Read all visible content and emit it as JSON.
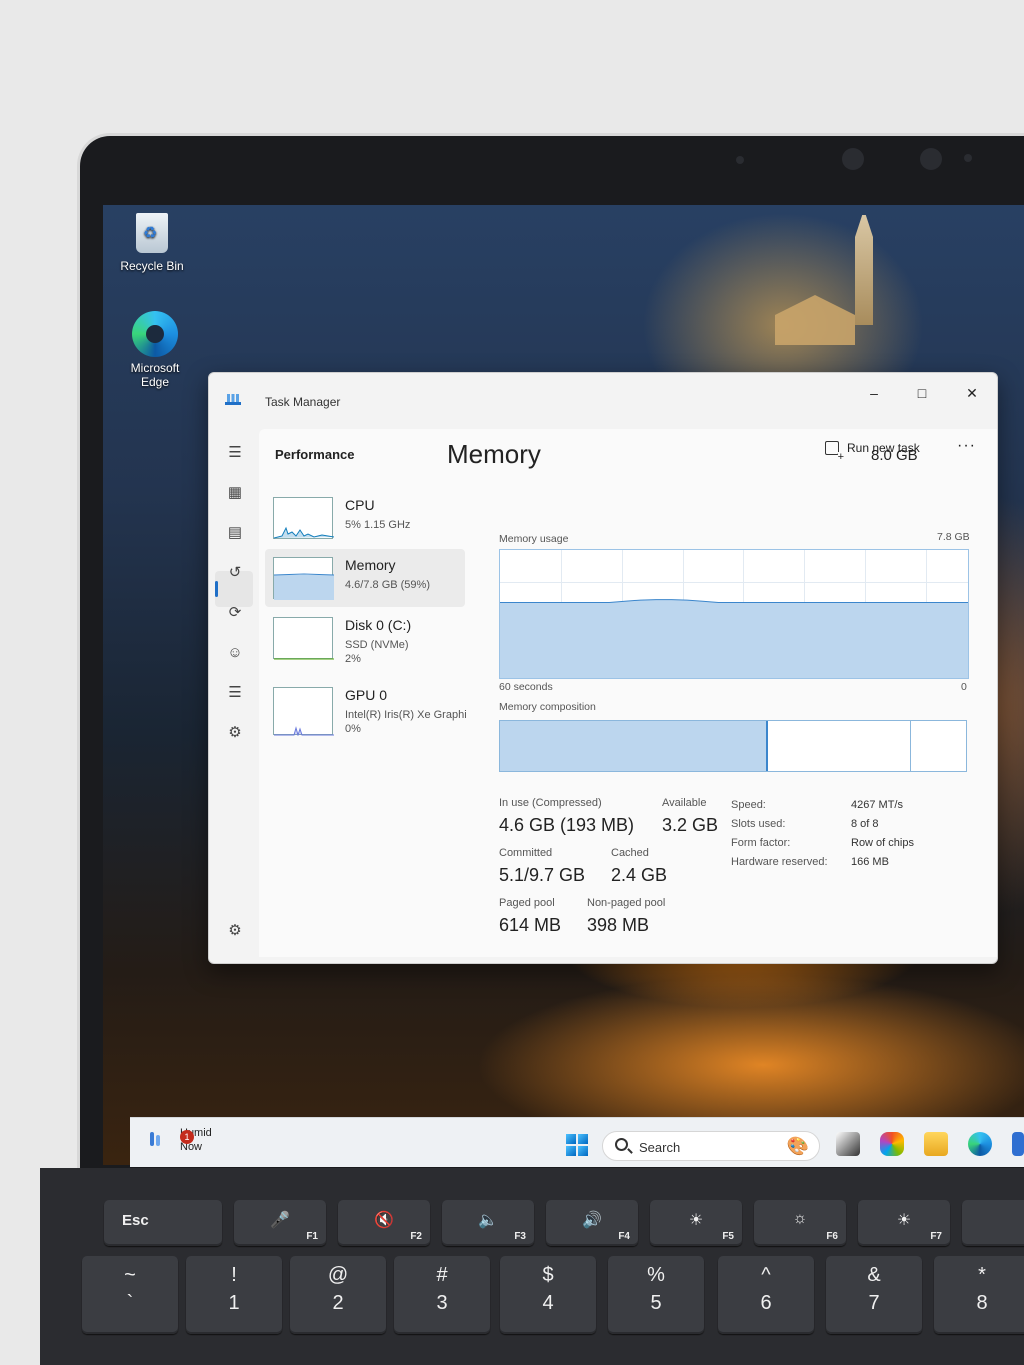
{
  "desktop": {
    "icons": [
      {
        "label": "Recycle Bin"
      },
      {
        "label_line1": "Microsoft",
        "label_line2": "Edge"
      }
    ]
  },
  "task_manager": {
    "title": "Task Manager",
    "window_controls": {
      "minimize": "–",
      "maximize": "□",
      "close": "✕"
    },
    "page_title": "Performance",
    "run_new_task": "Run new task",
    "more": "···",
    "resources": [
      {
        "name": "CPU",
        "sub1": "5%  1.15 GHz",
        "sub2": ""
      },
      {
        "name": "Memory",
        "sub1": "4.6/7.8 GB (59%)",
        "sub2": ""
      },
      {
        "name": "Disk 0 (C:)",
        "sub1": "SSD (NVMe)",
        "sub2": "2%"
      },
      {
        "name": "GPU 0",
        "sub1": "Intel(R) Iris(R) Xe Graphi",
        "sub2": "0%"
      }
    ],
    "memory": {
      "heading": "Memory",
      "total": "8.0 GB",
      "usage_label": "Memory usage",
      "usage_max": "7.8 GB",
      "x_left": "60 seconds",
      "x_right": "0",
      "usage_fraction": 0.59,
      "composition_label": "Memory composition",
      "composition": {
        "in_use": 0.575,
        "standby_end": 0.88
      },
      "stats": {
        "in_use_label": "In use (Compressed)",
        "in_use": "4.6 GB (193 MB)",
        "available_label": "Available",
        "available": "3.2 GB",
        "committed_label": "Committed",
        "committed": "5.1/9.7 GB",
        "cached_label": "Cached",
        "cached": "2.4 GB",
        "paged_label": "Paged pool",
        "paged": "614 MB",
        "nonpaged_label": "Non-paged pool",
        "nonpaged": "398 MB"
      },
      "specs": [
        {
          "label": "Speed:",
          "value": "4267 MT/s"
        },
        {
          "label": "Slots used:",
          "value": "8 of 8"
        },
        {
          "label": "Form factor:",
          "value": "Row of chips"
        },
        {
          "label": "Hardware reserved:",
          "value": "166 MB"
        }
      ]
    },
    "accent": "#1f6fc7"
  },
  "taskbar": {
    "weather_line1": "Humid",
    "weather_line2": "Now",
    "weather_badge": "1",
    "search_label": "Search"
  },
  "keyboard": {
    "row1": [
      {
        "main": "Esc",
        "fn": ""
      },
      {
        "main": "🎤",
        "fn": "F1"
      },
      {
        "main": "🔇",
        "fn": "F2"
      },
      {
        "main": "🔈",
        "fn": "F3"
      },
      {
        "main": "🔊",
        "fn": "F4"
      },
      {
        "main": "☀",
        "fn": "F5"
      },
      {
        "main": "☼",
        "fn": "F6"
      },
      {
        "main": "☀",
        "fn": "F7"
      }
    ],
    "row2": [
      {
        "top": "~",
        "bottom": "`"
      },
      {
        "top": "!",
        "bottom": "1"
      },
      {
        "top": "@",
        "bottom": "2"
      },
      {
        "top": "#",
        "bottom": "3"
      },
      {
        "top": "$",
        "bottom": "4"
      },
      {
        "top": "%",
        "bottom": "5"
      },
      {
        "top": "^",
        "bottom": "6"
      },
      {
        "top": "&",
        "bottom": "7"
      },
      {
        "top": "*",
        "bottom": "8"
      }
    ]
  }
}
